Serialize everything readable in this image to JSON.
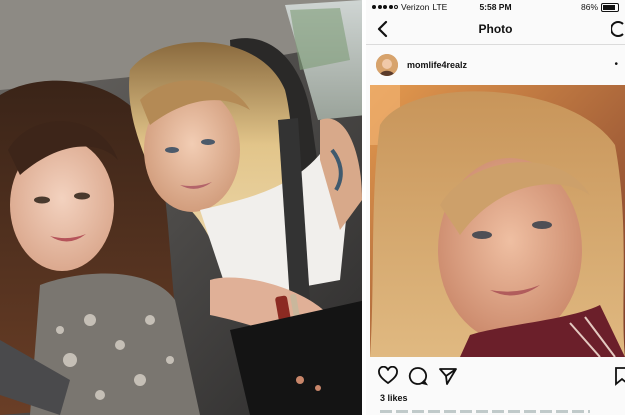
{
  "status_bar": {
    "carrier": "Verizon",
    "network": "LTE",
    "time": "5:58 PM",
    "battery": "86%"
  },
  "nav": {
    "title": "Photo"
  },
  "post": {
    "username": "momlife4realz",
    "likes": "3 likes"
  },
  "colors": {
    "ig_background": "#fafafa",
    "divider": "#dbdbdb",
    "text": "#111111"
  },
  "icons": {
    "back": "chevron-left-icon",
    "refresh": "refresh-icon",
    "more": "more-options-icon",
    "like": "heart-icon",
    "comment": "comment-icon",
    "share": "send-icon",
    "save": "bookmark-icon"
  }
}
